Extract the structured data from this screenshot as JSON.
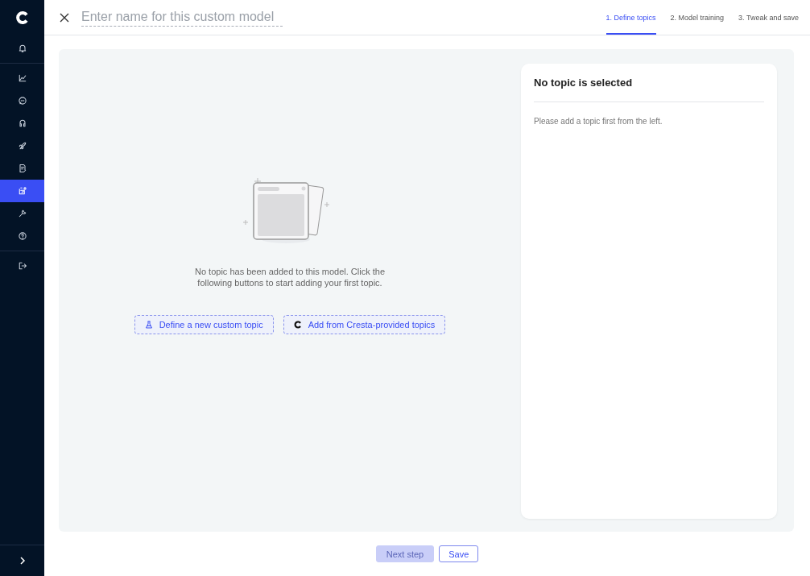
{
  "sidebar": {
    "items": [
      {
        "kind": "bell",
        "selected": false
      },
      {
        "kind": "chart",
        "selected": false
      },
      {
        "kind": "chat",
        "selected": false
      },
      {
        "kind": "headset",
        "selected": false
      },
      {
        "kind": "rocket",
        "selected": false
      },
      {
        "kind": "doc",
        "selected": false
      },
      {
        "kind": "model",
        "selected": true
      },
      {
        "kind": "wrench",
        "selected": false
      },
      {
        "kind": "help",
        "selected": false
      },
      {
        "kind": "logout",
        "selected": false
      }
    ]
  },
  "header": {
    "name_field": {
      "placeholder": "Enter name for this custom model"
    },
    "steps": [
      {
        "label": "1. Define topics",
        "selected": true
      },
      {
        "label": "2. Model training",
        "selected": false
      },
      {
        "label": "3. Tweak and save",
        "selected": false
      }
    ]
  },
  "empty_state": {
    "message": "No topic has been added to this model. Click the following buttons to start adding your first topic.",
    "buttons": [
      {
        "kind": "flask",
        "label": "Define a new custom topic"
      },
      {
        "kind": "logo",
        "label": "Add from Cresta-provided topics"
      }
    ]
  },
  "detail_panel": {
    "title": "No topic is selected",
    "message": "Please add a topic first from the left."
  },
  "footer": {
    "buttons": [
      {
        "label": "Next step",
        "disabled": true
      },
      {
        "label": "Save",
        "disabled": false
      }
    ]
  }
}
